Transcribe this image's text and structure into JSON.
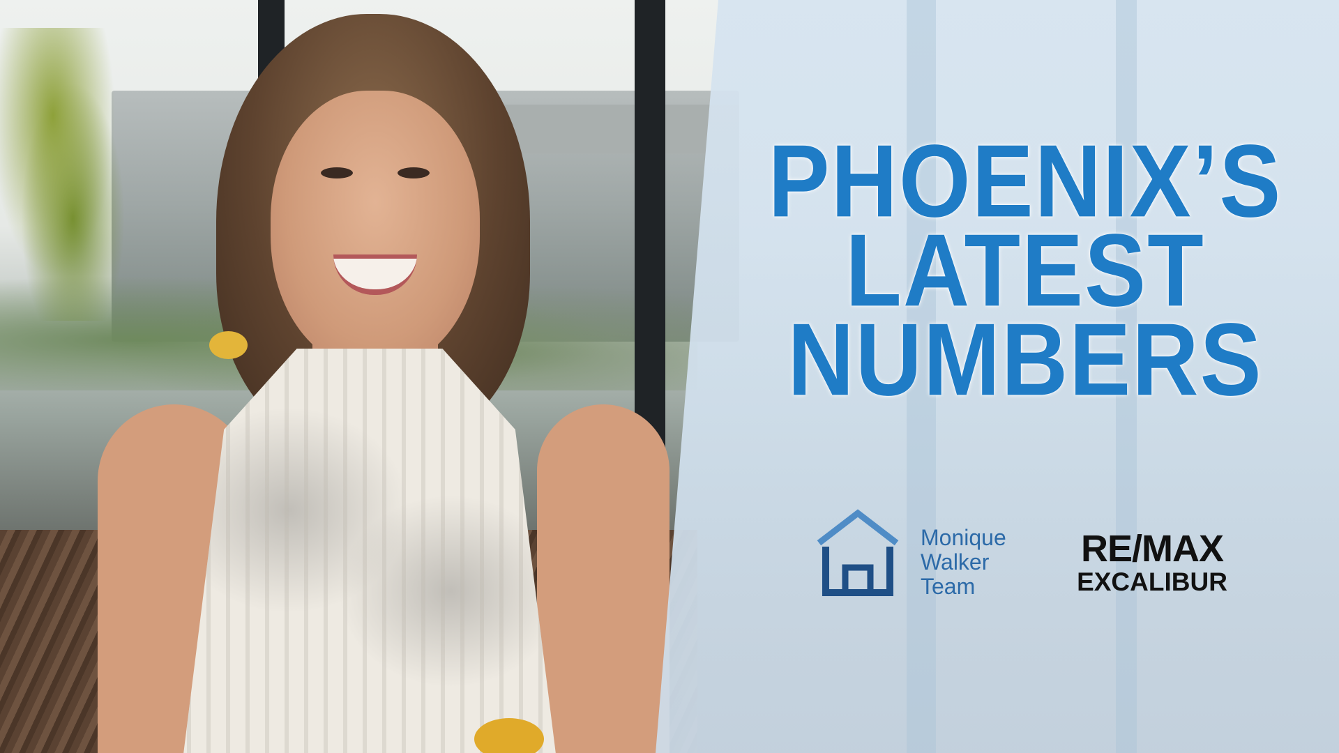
{
  "headline": {
    "line1": "PHOENIX’S",
    "line2": "LATEST",
    "line3": "NUMBERS"
  },
  "logos": {
    "team": {
      "line1": "Monique",
      "line2": "Walker",
      "line3": "Team",
      "icon": "house-outline-icon"
    },
    "brokerage": {
      "line1": "RE/MAX",
      "line2": "EXCALIBUR"
    }
  },
  "colors": {
    "headline": "#1f7cc6",
    "team_text": "#2c6aa8",
    "house_icon_top": "#4f8cc6",
    "house_icon_bottom": "#1f4f86",
    "brokerage_text": "#111111",
    "panel": "#d4e3ef"
  }
}
